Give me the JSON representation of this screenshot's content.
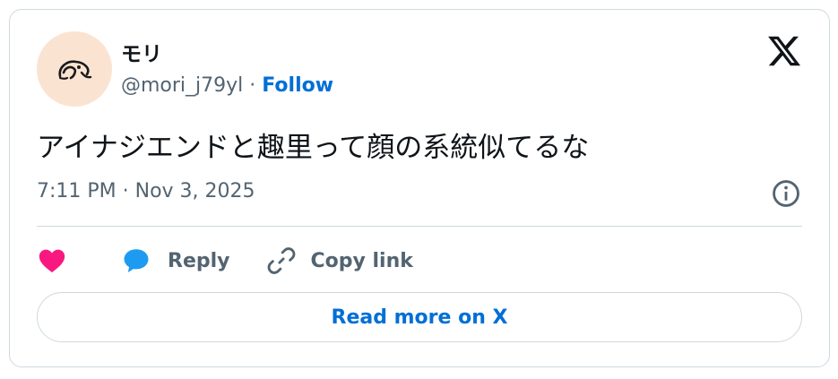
{
  "author": {
    "display_name": "モリ",
    "handle": "@mori_j79yl",
    "separator": "·",
    "follow_label": "Follow"
  },
  "tweet": {
    "text": "アイナジエンドと趣里って顔の系統似てるな",
    "timestamp": "7:11 PM · Nov 3, 2025"
  },
  "actions": {
    "reply_label": "Reply",
    "copy_link_label": "Copy link"
  },
  "read_more_label": "Read more on X",
  "colors": {
    "accent": "#006fd6",
    "heart": "#f91880",
    "reply_bubble": "#1d9bf0",
    "muted": "#536471",
    "border": "#cfd9de",
    "avatar_bg": "#fbe3d2"
  },
  "icons": {
    "logo": "x-logo-icon",
    "info": "info-icon",
    "like": "heart-icon",
    "reply": "speech-bubble-icon",
    "copy": "link-icon"
  }
}
